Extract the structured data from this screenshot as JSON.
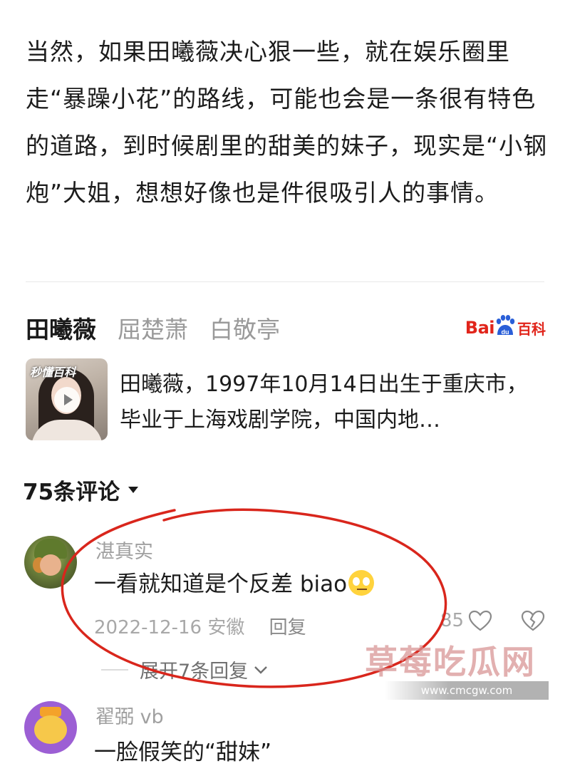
{
  "article": {
    "paragraph": "当然，如果田曦薇决心狠一些，就在娱乐圈里走“暴躁小花”的路线，可能也会是一条很有特色的道路，到时候剧里的甜美的妹子，现实是“小钢炮”大姐，想想好像也是件很吸引人的事情。"
  },
  "tags": [
    "田曦薇",
    "屈楚萧",
    "白敬亭"
  ],
  "baike": {
    "logo_bai": "Bai",
    "logo_du": "du",
    "logo_ke": "百科",
    "thumb_brand": "秒懂百科",
    "summary": "田曦薇，1997年10月14日出生于重庆市，毕业于上海戏剧学院，中国内地…"
  },
  "comments_header": {
    "label": "75条评论"
  },
  "comments": [
    {
      "username": "湛真实",
      "text": "一看就知道是个反差 biao",
      "emoji": "eye-roll-emoji",
      "date": "2022-12-16",
      "location": "安徽",
      "reply_label": "回复",
      "likes": "85",
      "expand_label": "展开7条回复"
    },
    {
      "username": "翟弼 vb",
      "text": "一脸假笑的“甜妹”"
    }
  ],
  "watermark": {
    "text": "草莓吃瓜网",
    "url": "www.cmcgw.com"
  },
  "colors": {
    "annotation_red": "#d9261c",
    "baidu_red": "#e1251b",
    "baidu_blue": "#2a5fd8"
  }
}
